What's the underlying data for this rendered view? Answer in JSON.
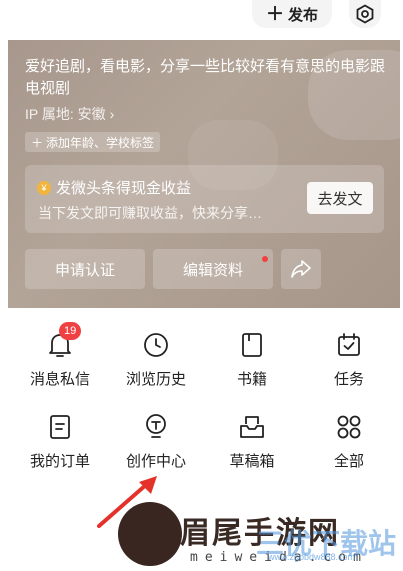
{
  "header": {
    "publish_label": "发布",
    "publish_icon": "plus-icon",
    "settings_icon": "hexagon-settings-icon"
  },
  "profile": {
    "bio": "爱好追剧，看电影，分享一些比较好看有意思的电影跟电视剧",
    "ip_label": "IP 属地: 安徽",
    "add_tag_label": "添加年龄、学校标签"
  },
  "earn_card": {
    "title": "发微头条得现金收益",
    "subtitle": "当下发文即可赚取收益，快来分享…",
    "button_label": "去发文",
    "coin_symbol": "¥"
  },
  "actions": {
    "verify_label": "申请认证",
    "edit_label": "编辑资料"
  },
  "grid": {
    "items": [
      {
        "label": "消息私信",
        "icon": "bell-icon",
        "badge": "19"
      },
      {
        "label": "浏览历史",
        "icon": "clock-icon"
      },
      {
        "label": "书籍",
        "icon": "book-icon"
      },
      {
        "label": "任务",
        "icon": "calendar-check-icon"
      },
      {
        "label": "我的订单",
        "icon": "order-list-icon"
      },
      {
        "label": "创作中心",
        "icon": "lightbulb-icon"
      },
      {
        "label": "草稿箱",
        "icon": "draft-box-icon"
      },
      {
        "label": "全部",
        "icon": "grid-four-circles-icon"
      }
    ]
  },
  "watermark": {
    "title": "眉尾手游网",
    "subtitle": "meiweida.com",
    "overlay_text": "三优下载站",
    "overlay_url": "www.zgbbdw888.com"
  },
  "colors": {
    "accent_red": "#f04142",
    "hero_bg": "#ad9d91",
    "coin": "#f2b53c"
  }
}
